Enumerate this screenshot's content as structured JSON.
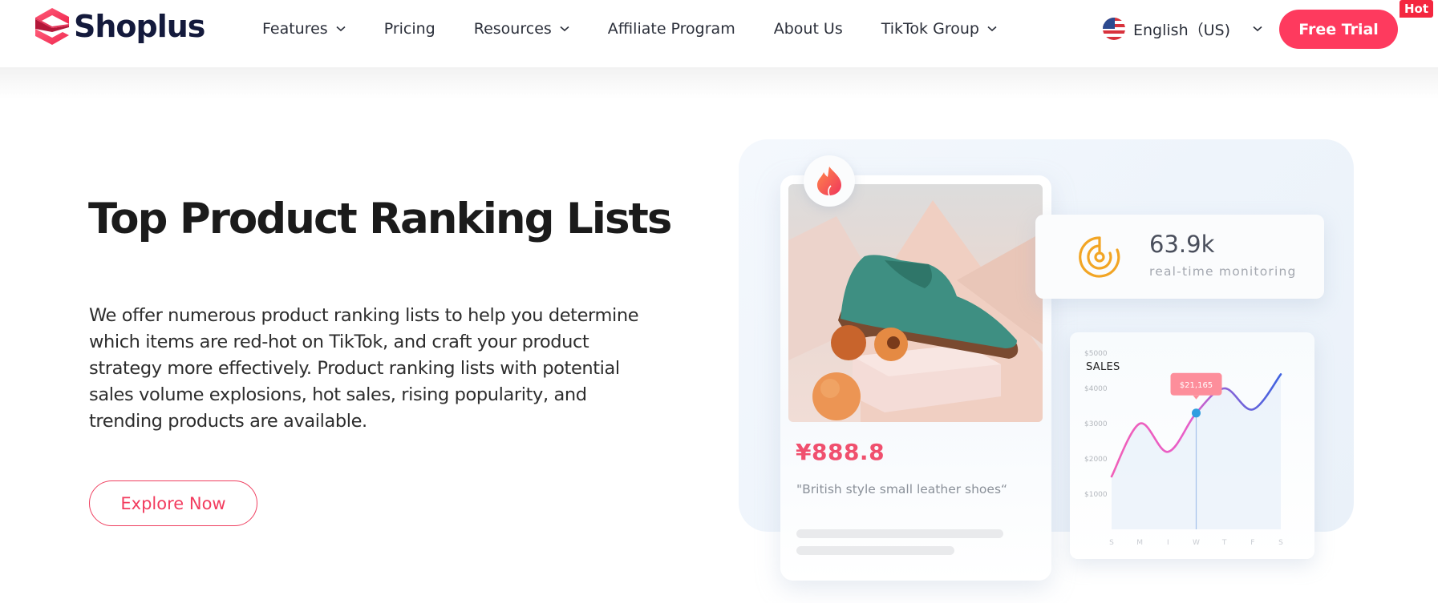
{
  "header": {
    "brand": "Shoplus",
    "nav": [
      {
        "label": "Features",
        "has_dropdown": true
      },
      {
        "label": "Pricing",
        "has_dropdown": false
      },
      {
        "label": "Resources",
        "has_dropdown": true
      },
      {
        "label": "Affiliate Program",
        "has_dropdown": false
      },
      {
        "label": "About Us",
        "has_dropdown": false
      },
      {
        "label": "TikTok Group",
        "has_dropdown": true
      }
    ],
    "language": {
      "label": "English（US)",
      "icon": "us-flag-icon"
    },
    "cta": {
      "label": "Free Trial",
      "badge": "Hot"
    },
    "colors": {
      "brand": "#fe3a5e",
      "badge": "#f4263f",
      "logo_text": "#141a3c"
    }
  },
  "hero": {
    "title": "Top Product Ranking Lists",
    "description": "We offer numerous product ranking lists to help you determine which items are red-hot on TikTok, and craft your product strategy more effectively. Product ranking lists with potential sales volume explosions, hot sales, rising popularity, and trending products are available.",
    "button": "Explore Now"
  },
  "illustration": {
    "product": {
      "price": "¥888.8",
      "name": "\"British style small leather shoes“",
      "icon": "flame-icon"
    },
    "monitor": {
      "value": "63.9k",
      "label": "real-time monitoring",
      "icon": "radar-icon"
    },
    "sales_chart": {
      "title": "SALES",
      "y_ticks": [
        "$5000",
        "$4000",
        "$3000",
        "$2000",
        "$1000"
      ],
      "x_ticks": [
        "S",
        "M",
        "I",
        "W",
        "T",
        "F",
        "S"
      ],
      "tooltip": "$21,165",
      "highlight_index": 3
    }
  },
  "chart_data": {
    "type": "line",
    "title": "SALES",
    "categories": [
      "S",
      "M",
      "I",
      "W",
      "T",
      "F",
      "S"
    ],
    "series": [
      {
        "name": "Sales",
        "values": [
          1500,
          3000,
          2200,
          3300,
          4000,
          3400,
          4400
        ]
      }
    ],
    "ylabel": "",
    "xlabel": "",
    "ylim": [
      0,
      5000
    ],
    "y_ticks": [
      1000,
      2000,
      3000,
      4000,
      5000
    ],
    "annotation": {
      "index": 3,
      "label": "$21,165"
    },
    "grid": false,
    "legend": "none"
  }
}
